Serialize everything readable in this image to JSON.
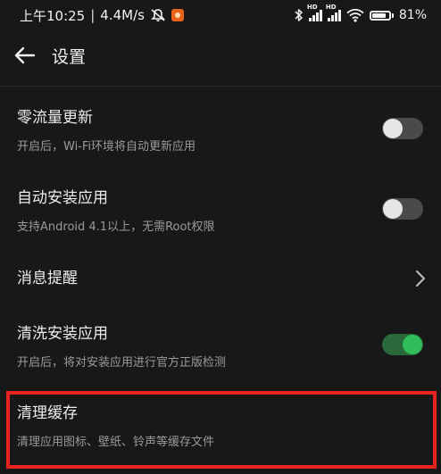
{
  "status_bar": {
    "time": "上午10:25",
    "separator": "|",
    "speed": "4.4M/s",
    "battery_percent": "81%",
    "battery_level": 0.81,
    "hd_label": "HD"
  },
  "header": {
    "title": "设置"
  },
  "settings": [
    {
      "title": "零流量更新",
      "desc": "开启后，Wi-Fi环境将自动更新应用",
      "control": "toggle",
      "on": false
    },
    {
      "title": "自动安装应用",
      "desc": "支持Android 4.1以上，无需Root权限",
      "control": "toggle",
      "on": false
    },
    {
      "title": "消息提醒",
      "control": "chevron"
    },
    {
      "title": "清洗安装应用",
      "desc": "开启后，将对安装应用进行官方正版检测",
      "control": "toggle",
      "on": true
    },
    {
      "title": "清理缓存",
      "desc": "清理应用图标、壁纸、铃声等缓存文件",
      "control": "none"
    }
  ],
  "colors": {
    "background": "#181818",
    "toggle_on": "#2fbe5a",
    "highlight": "#e8231f"
  },
  "icons": {
    "back": "arrow-left-icon",
    "chevron": "chevron-right-icon",
    "mute": "mute-icon",
    "bluetooth": "bluetooth-icon",
    "wifi": "wifi-icon",
    "battery": "battery-icon"
  }
}
